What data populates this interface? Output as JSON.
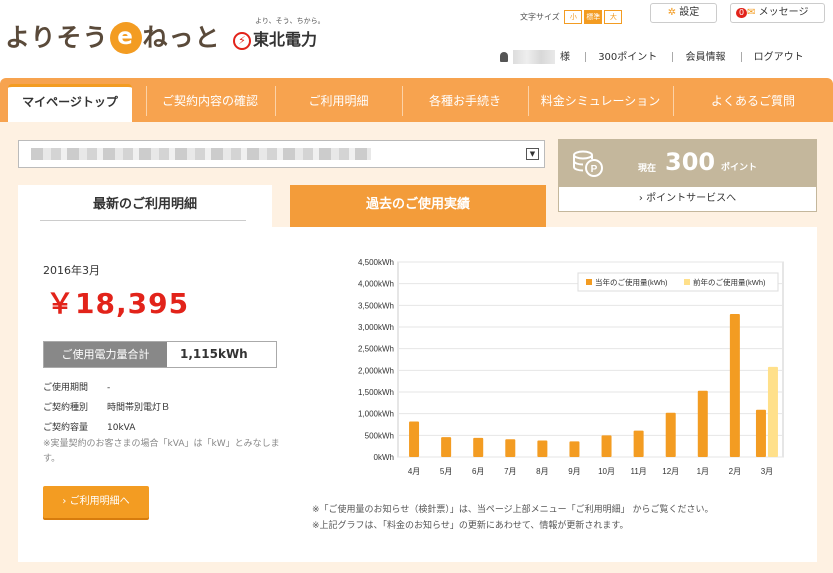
{
  "header": {
    "logo_text_before": "よりそう",
    "logo_e": "e",
    "logo_text_after": "ねっと",
    "brand": "東北電力",
    "brand_slogan": "より、そう、ちから。",
    "font_size_label": "文字サイズ",
    "font_size_options": [
      "小",
      "標準",
      "大"
    ],
    "settings_label": "設定",
    "message_badge": "0",
    "messages_label": "メッセージ",
    "user_suffix": "様",
    "points_link": "300ポイント",
    "member_info": "会員情報",
    "logout": "ログアウト"
  },
  "nav": {
    "tabs": [
      "マイページトップ",
      "ご契約内容の確認",
      "ご利用明細",
      "各種お手続き",
      "料金シミュレーション",
      "よくあるご質問"
    ]
  },
  "points": {
    "now_label": "現在",
    "value": "300",
    "unit": "ポイント",
    "service_link": "ポイントサービスへ"
  },
  "tabs": {
    "latest": "最新のご利用明細",
    "past": "過去のご使用実績"
  },
  "bill": {
    "month": "2016年3月",
    "amount": "￥18,395",
    "usage_label": "ご使用電力量合計",
    "usage_value": "1,115kWh",
    "period_label": "ご使用期間",
    "period_value": "-",
    "type_label": "ご契約種別",
    "type_value": "時間帯別電灯Ｂ",
    "capacity_label": "ご契約容量",
    "capacity_value": "10kVA",
    "note": "※実量契約のお客さまの場合「kVA」は「kW」とみなします。",
    "detail_button": "ご利用明細へ"
  },
  "footnotes": [
    "※「ご使用量のお知らせ（検針票）」は、当ページ上部メニュー「ご利用明細」 からご覧ください。",
    "※上記グラフは、「料金のお知らせ」の更新にあわせて、情報が更新されます。"
  ],
  "colors": {
    "accent": "#f39c22",
    "nav": "#f7a34f",
    "current_year": "#f39c22",
    "previous_year": "#ffe08a",
    "amount": "#e2231a"
  },
  "chart_data": {
    "type": "bar",
    "categories": [
      "4月",
      "5月",
      "6月",
      "7月",
      "8月",
      "9月",
      "10月",
      "11月",
      "12月",
      "1月",
      "2月",
      "3月"
    ],
    "series": [
      {
        "name": "当年のご使用量(kWh)",
        "values": [
          820,
          460,
          440,
          410,
          380,
          360,
          500,
          610,
          1020,
          1530,
          3300,
          1090
        ]
      },
      {
        "name": "前年のご使用量(kWh)",
        "values": [
          null,
          null,
          null,
          null,
          null,
          null,
          null,
          null,
          null,
          null,
          null,
          2080
        ]
      }
    ],
    "y_ticks": [
      "0kWh",
      "500kWh",
      "1,000kWh",
      "1,500kWh",
      "2,000kWh",
      "2,500kWh",
      "3,000kWh",
      "3,500kWh",
      "4,000kWh",
      "4,500kWh"
    ],
    "ylim": [
      0,
      4500
    ],
    "grid": true,
    "legend": "top-right"
  }
}
